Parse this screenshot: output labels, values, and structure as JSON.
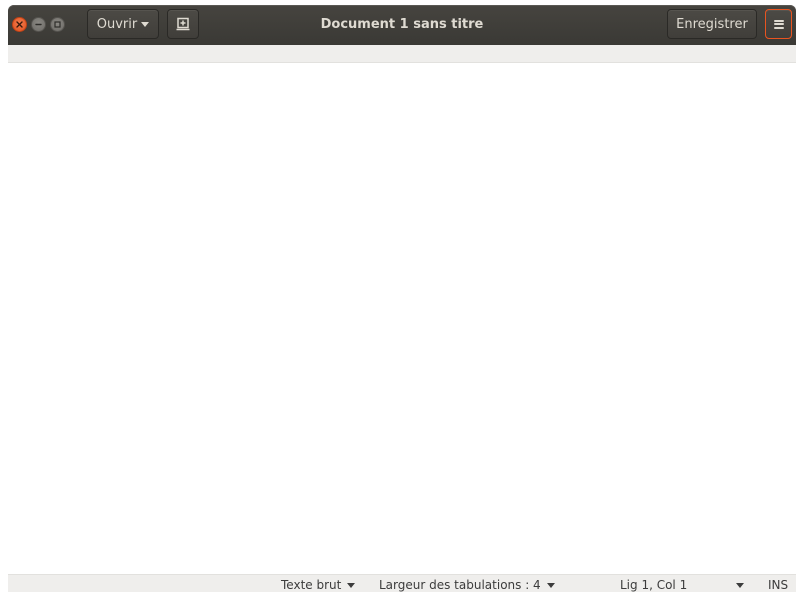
{
  "window": {
    "title": "Document 1 sans titre"
  },
  "header": {
    "open_label": "Ouvrir",
    "save_label": "Enregistrer"
  },
  "statusbar": {
    "language": "Texte brut",
    "tab_width": "Largeur des tabulations : 4",
    "cursor_position": "Lig 1, Col 1",
    "insert_mode": "INS"
  },
  "colors": {
    "header_bg": "#3e3d39",
    "accent": "#e95420",
    "statusbar_bg": "#efeeec"
  },
  "icons": {
    "close": "close-icon",
    "minimize": "minimize-icon",
    "maximize": "maximize-icon",
    "open_dropdown": "chevron-down-icon",
    "new_tab": "new-document-icon",
    "menu": "hamburger-menu-icon"
  }
}
